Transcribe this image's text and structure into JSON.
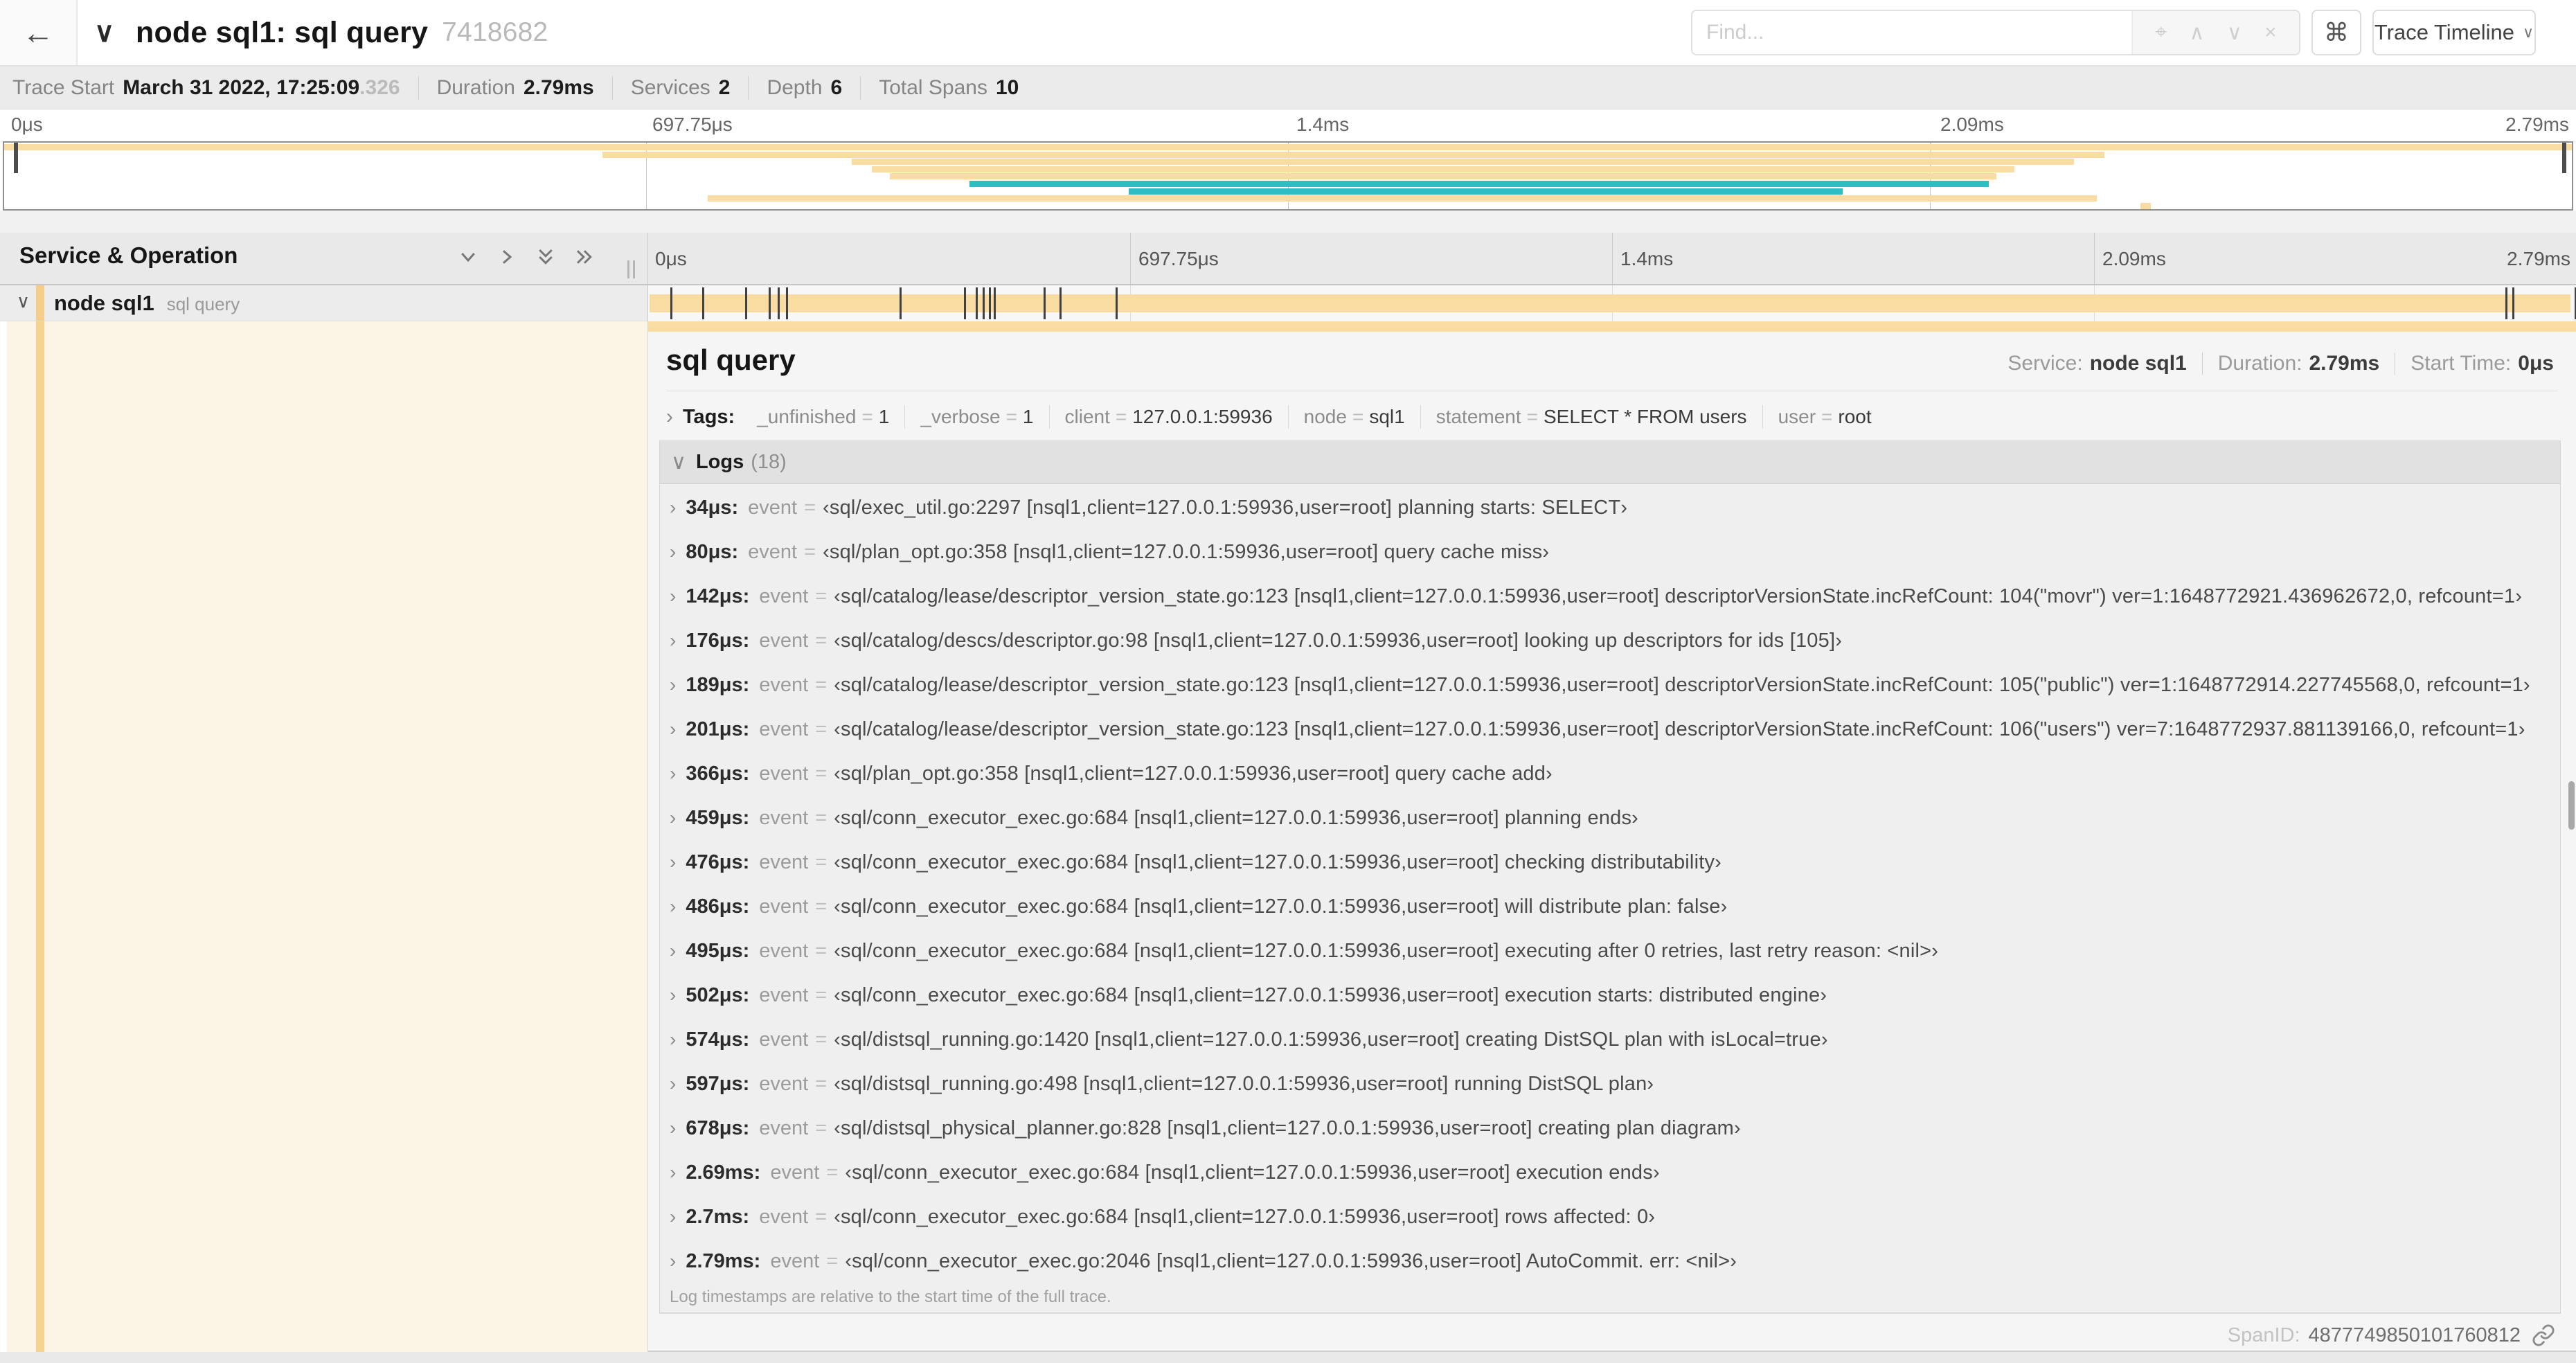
{
  "header": {
    "back_icon": "←",
    "collapse_chevron": "∨",
    "title": "node sql1: sql query",
    "trace_id": "7418682",
    "find_placeholder": "Find...",
    "find_icons": {
      "target": "⌖",
      "prev": "∧",
      "next": "∨",
      "clear": "×"
    },
    "shortcut_icon": "⌘",
    "view_selector": "Trace Timeline",
    "view_caret": "∨"
  },
  "trace_meta": {
    "trace_start_label": "Trace Start",
    "trace_start_value": "March 31 2022, 17:25:09",
    "trace_start_frac": ".326",
    "duration_label": "Duration",
    "duration_value": "2.79ms",
    "services_label": "Services",
    "services_value": "2",
    "depth_label": "Depth",
    "depth_value": "6",
    "spans_label": "Total Spans",
    "spans_value": "10"
  },
  "minimap": {
    "tick_labels": [
      "0μs",
      "697.75μs",
      "1.4ms",
      "2.09ms",
      "2.79ms"
    ],
    "colors": {
      "span": "#f8dca1",
      "active": "#2dbec4"
    },
    "bars": [
      {
        "start": 0.0,
        "end": 1.0,
        "color": "span"
      },
      {
        "start": 0.233,
        "end": 0.818,
        "color": "span"
      },
      {
        "start": 0.33,
        "end": 0.806,
        "color": "span"
      },
      {
        "start": 0.338,
        "end": 0.783,
        "color": "span"
      },
      {
        "start": 0.345,
        "end": 0.776,
        "color": "span"
      },
      {
        "start": 0.376,
        "end": 0.773,
        "color": "active"
      },
      {
        "start": 0.438,
        "end": 0.716,
        "color": "active"
      },
      {
        "start": 0.274,
        "end": 0.815,
        "color": "span"
      },
      {
        "start": 0.832,
        "end": 0.836,
        "color": "span"
      }
    ]
  },
  "timeline": {
    "left_header": "Service & Operation",
    "tick_labels": [
      "0μs",
      "697.75μs",
      "1.4ms",
      "2.09ms",
      "2.79ms"
    ],
    "row": {
      "service": "node sql1",
      "operation": "sql query",
      "chevron": "∨"
    },
    "duration_us": 2790,
    "log_marks_us": [
      34,
      80,
      142,
      176,
      189,
      201,
      366,
      459,
      476,
      486,
      495,
      502,
      574,
      597,
      678,
      2690,
      2700,
      2790
    ]
  },
  "detail": {
    "title": "sql query",
    "service_label": "Service:",
    "service_value": "node sql1",
    "duration_label": "Duration:",
    "duration_value": "2.79ms",
    "start_label": "Start Time:",
    "start_value": "0μs",
    "tags_chevron": "›",
    "tags_label": "Tags:",
    "tags": [
      {
        "key": "_unfinished",
        "value": "1"
      },
      {
        "key": "_verbose",
        "value": "1"
      },
      {
        "key": "client",
        "value": "127.0.0.1:59936"
      },
      {
        "key": "node",
        "value": "sql1"
      },
      {
        "key": "statement",
        "value": "SELECT * FROM users"
      },
      {
        "key": "user",
        "value": "root"
      }
    ],
    "logs_chevron": "∨",
    "logs_label": "Logs",
    "logs_count": "(18)",
    "log_field": "event",
    "logs": [
      {
        "time": "34μs:",
        "value": "‹sql/exec_util.go:2297 [nsql1,client=127.0.0.1:59936,user=root] planning starts: SELECT›"
      },
      {
        "time": "80μs:",
        "value": "‹sql/plan_opt.go:358 [nsql1,client=127.0.0.1:59936,user=root] query cache miss›"
      },
      {
        "time": "142μs:",
        "value": "‹sql/catalog/lease/descriptor_version_state.go:123 [nsql1,client=127.0.0.1:59936,user=root] descriptorVersionState.incRefCount: 104(\"movr\") ver=1:1648772921.436962672,0, refcount=1›"
      },
      {
        "time": "176μs:",
        "value": "‹sql/catalog/descs/descriptor.go:98 [nsql1,client=127.0.0.1:59936,user=root] looking up descriptors for ids [105]›"
      },
      {
        "time": "189μs:",
        "value": "‹sql/catalog/lease/descriptor_version_state.go:123 [nsql1,client=127.0.0.1:59936,user=root] descriptorVersionState.incRefCount: 105(\"public\") ver=1:1648772914.227745568,0, refcount=1›"
      },
      {
        "time": "201μs:",
        "value": "‹sql/catalog/lease/descriptor_version_state.go:123 [nsql1,client=127.0.0.1:59936,user=root] descriptorVersionState.incRefCount: 106(\"users\") ver=7:1648772937.881139166,0, refcount=1›"
      },
      {
        "time": "366μs:",
        "value": "‹sql/plan_opt.go:358 [nsql1,client=127.0.0.1:59936,user=root] query cache add›"
      },
      {
        "time": "459μs:",
        "value": "‹sql/conn_executor_exec.go:684 [nsql1,client=127.0.0.1:59936,user=root] planning ends›"
      },
      {
        "time": "476μs:",
        "value": "‹sql/conn_executor_exec.go:684 [nsql1,client=127.0.0.1:59936,user=root] checking distributability›"
      },
      {
        "time": "486μs:",
        "value": "‹sql/conn_executor_exec.go:684 [nsql1,client=127.0.0.1:59936,user=root] will distribute plan: false›"
      },
      {
        "time": "495μs:",
        "value": "‹sql/conn_executor_exec.go:684 [nsql1,client=127.0.0.1:59936,user=root] executing after 0 retries, last retry reason: <nil>›"
      },
      {
        "time": "502μs:",
        "value": "‹sql/conn_executor_exec.go:684 [nsql1,client=127.0.0.1:59936,user=root] execution starts: distributed engine›"
      },
      {
        "time": "574μs:",
        "value": "‹sql/distsql_running.go:1420 [nsql1,client=127.0.0.1:59936,user=root] creating DistSQL plan with isLocal=true›"
      },
      {
        "time": "597μs:",
        "value": "‹sql/distsql_running.go:498 [nsql1,client=127.0.0.1:59936,user=root] running DistSQL plan›"
      },
      {
        "time": "678μs:",
        "value": "‹sql/distsql_physical_planner.go:828 [nsql1,client=127.0.0.1:59936,user=root] creating plan diagram›"
      },
      {
        "time": "2.69ms:",
        "value": "‹sql/conn_executor_exec.go:684 [nsql1,client=127.0.0.1:59936,user=root] execution ends›"
      },
      {
        "time": "2.7ms:",
        "value": "‹sql/conn_executor_exec.go:684 [nsql1,client=127.0.0.1:59936,user=root] rows affected: 0›"
      },
      {
        "time": "2.79ms:",
        "value": "‹sql/conn_executor_exec.go:2046 [nsql1,client=127.0.0.1:59936,user=root] AutoCommit. err: <nil>›"
      }
    ],
    "logs_note": "Log timestamps are relative to the start time of the full trace.",
    "spanid_label": "SpanID:",
    "spanid_value": "4877749850101760812"
  }
}
